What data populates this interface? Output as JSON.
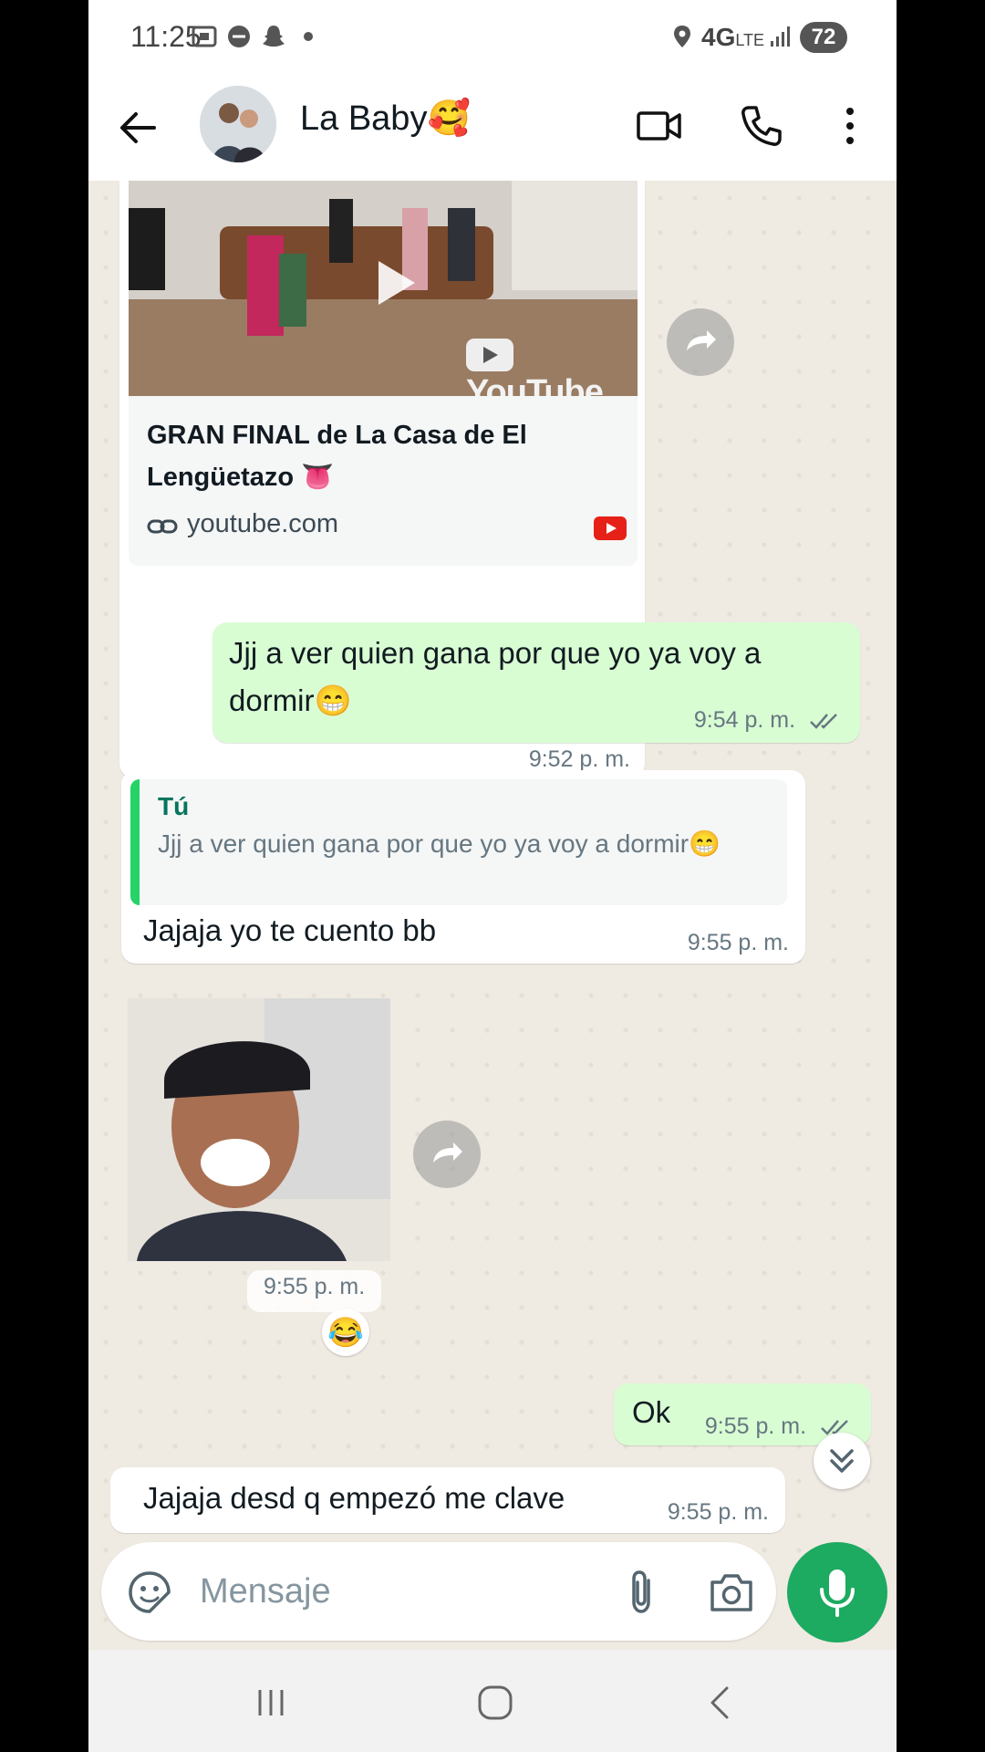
{
  "status_bar": {
    "time": "11:25",
    "network": "4G",
    "network_sub": "LTE",
    "battery": "72"
  },
  "header": {
    "contact_name": "La Baby🥰"
  },
  "messages": {
    "link_preview": {
      "title": "GRAN FINAL de La Casa de El Lengüetazo 👅",
      "domain": "youtube.com",
      "watermark": "YouTube",
      "time": "9:52 p. m."
    },
    "out_1": {
      "text": "Jjj a ver quien gana por que yo ya voy a dormir😁",
      "time": "9:54 p. m."
    },
    "reply": {
      "quote_author": "Tú",
      "quote_text": "Jjj a ver quien gana por que yo ya voy a dormir😁",
      "text": "Jajaja yo te cuento bb",
      "time": "9:55 p. m."
    },
    "photo": {
      "time": "9:55 p. m.",
      "reaction": "😂"
    },
    "out_2": {
      "text": "Ok",
      "time": "9:55 p. m."
    },
    "in_last": {
      "text": "Jajaja desd q empezó me clave",
      "time": "9:55 p. m."
    }
  },
  "input": {
    "placeholder": "Mensaje"
  },
  "colors": {
    "accent": "#1daa61",
    "outgoing_bubble": "#d9fdd3",
    "chat_background": "#efeae2",
    "read_ticks": "#53bdeb"
  }
}
